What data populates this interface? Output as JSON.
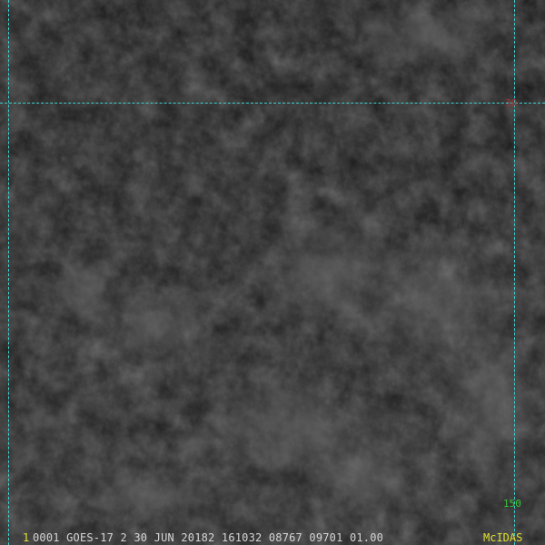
{
  "image": {
    "grid": {
      "line_color": "#3fd0d0",
      "lat_label": {
        "text": "30",
        "color": "#b03030"
      },
      "lon_label": {
        "text": "150",
        "color": "#38c838"
      }
    }
  },
  "status_bar": {
    "frame_number": "1",
    "frame_color": "#e0e030",
    "text": "0001 GOES-17     2 30 JUN 20182 161032 08767 09701 01.00",
    "brand": "McIDAS",
    "brand_color": "#e0e030"
  }
}
